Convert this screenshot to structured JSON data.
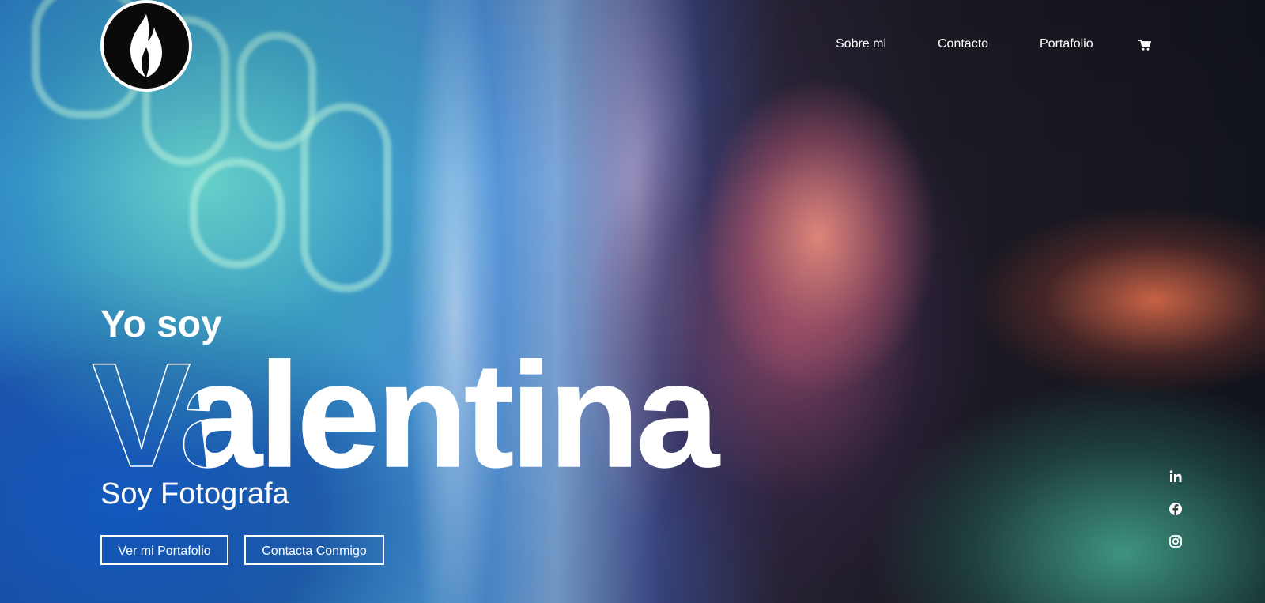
{
  "nav": {
    "items": [
      {
        "label": "Sobre mi"
      },
      {
        "label": "Contacto"
      },
      {
        "label": "Portafolio"
      }
    ],
    "cart_icon": "cart-icon"
  },
  "logo": {
    "icon": "flame-logo-icon"
  },
  "hero": {
    "intro": "Yo soy",
    "name": "Valentina",
    "role": "Soy Fotografa",
    "buttons": {
      "portfolio": "Ver mi Portafolio",
      "contact": "Contacta Conmigo"
    }
  },
  "social": {
    "icons": [
      "linkedin-icon",
      "facebook-icon",
      "instagram-icon"
    ]
  },
  "colors": {
    "text": "#ffffff",
    "logo_bg": "#0a0a0a"
  }
}
